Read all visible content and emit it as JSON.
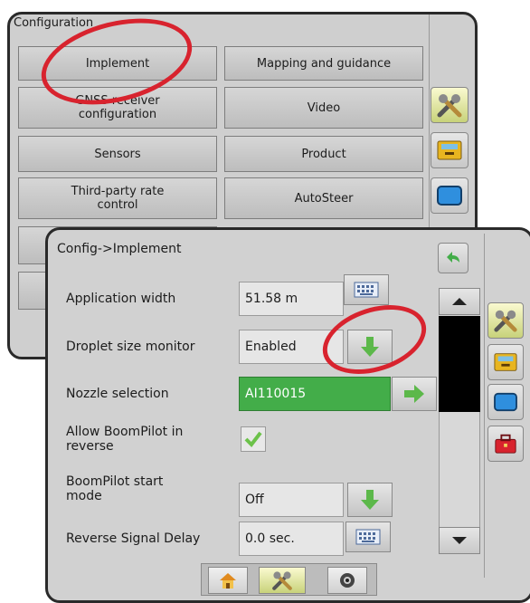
{
  "config": {
    "title": "Configuration",
    "buttons": [
      {
        "label": "Implement"
      },
      {
        "label": "Mapping and guidance"
      },
      {
        "label": "GNSS receiver configuration"
      },
      {
        "label": "Video"
      },
      {
        "label": "Sensors"
      },
      {
        "label": "Product"
      },
      {
        "label": "Third-party rate control"
      },
      {
        "label": "AutoSteer"
      }
    ],
    "side_icons": [
      "tools-icon",
      "console-icon",
      "screen-icon"
    ]
  },
  "implement": {
    "breadcrumb": "Config->Implement",
    "rows": [
      {
        "label": "Application width",
        "value": "51.58 m",
        "control": "keyboard-icon"
      },
      {
        "label": "Droplet size monitor",
        "value": "Enabled",
        "control": "down-arrow-icon"
      },
      {
        "label": "Nozzle selection",
        "value": "AI110015",
        "control": "right-arrow-icon"
      },
      {
        "label": "Allow BoomPilot in reverse",
        "value": "checked",
        "control": "checkbox"
      },
      {
        "label": "BoomPilot start mode",
        "value": "Off",
        "control": "down-arrow-icon"
      },
      {
        "label": "Reverse Signal Delay",
        "value": "0.0 sec.",
        "control": "keyboard-icon"
      }
    ],
    "side_icons": [
      "tools-icon",
      "console-icon",
      "screen-icon",
      "toolbox-icon"
    ],
    "bottom_tabs": [
      "home-icon",
      "tools-icon",
      "camera-icon"
    ]
  },
  "colors": {
    "accent_green": "#43ad49",
    "arrow_green": "#5cb84a",
    "highlight_red": "#d8232e"
  }
}
